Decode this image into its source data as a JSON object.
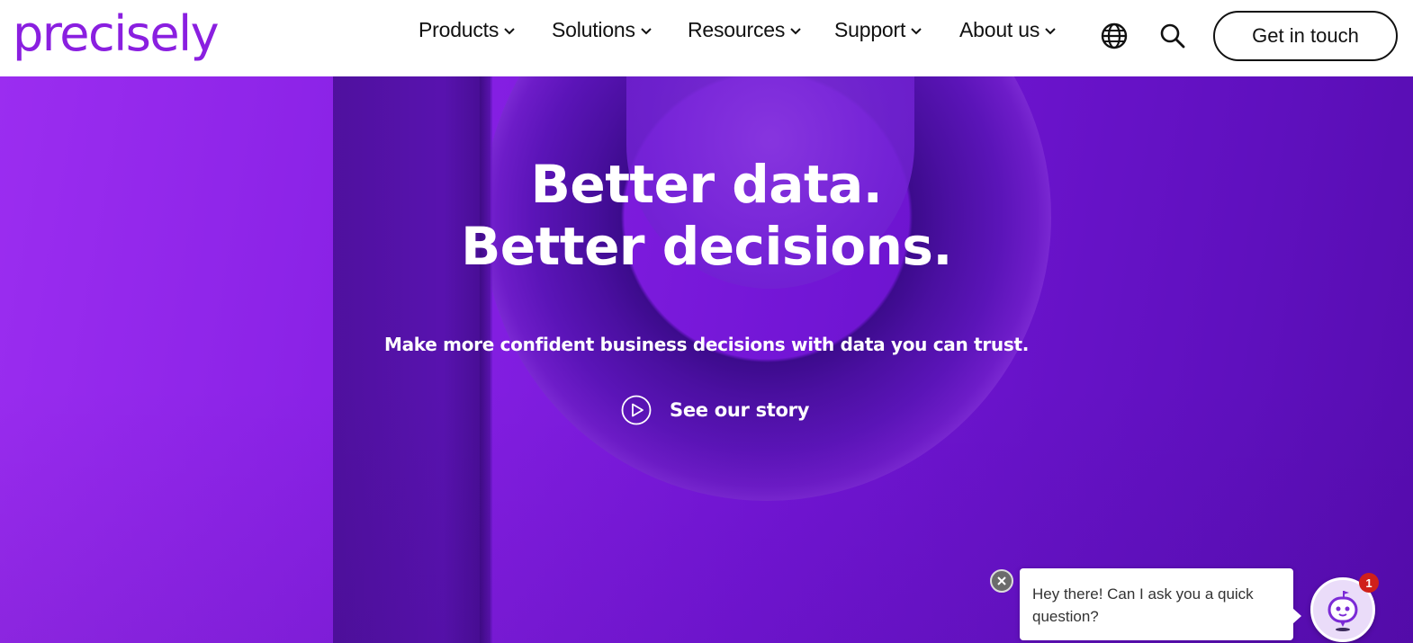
{
  "header": {
    "logo_text": "precisely",
    "nav": [
      {
        "label": "Products"
      },
      {
        "label": "Solutions"
      },
      {
        "label": "Resources"
      },
      {
        "label": "Support"
      },
      {
        "label": "About us"
      }
    ],
    "icons": {
      "language": "globe-icon",
      "search": "search-icon",
      "dropdown": "chevron-down-icon"
    },
    "cta_label": "Get in touch"
  },
  "hero": {
    "headline_line1": "Better data.",
    "headline_line2": "Better decisions.",
    "subtitle": "Make more confident business decisions with data you can trust.",
    "story_label": "See our story",
    "story_icon": "play-icon"
  },
  "chat": {
    "message": "Hey there! Can I ask you a quick question?",
    "badge_count": "1",
    "avatar_icon": "chatbot-icon",
    "close_icon": "close-icon"
  },
  "colors": {
    "brand": "#8a1fe0",
    "hero_purple": "#7316d6",
    "badge_red": "#d0201a"
  }
}
